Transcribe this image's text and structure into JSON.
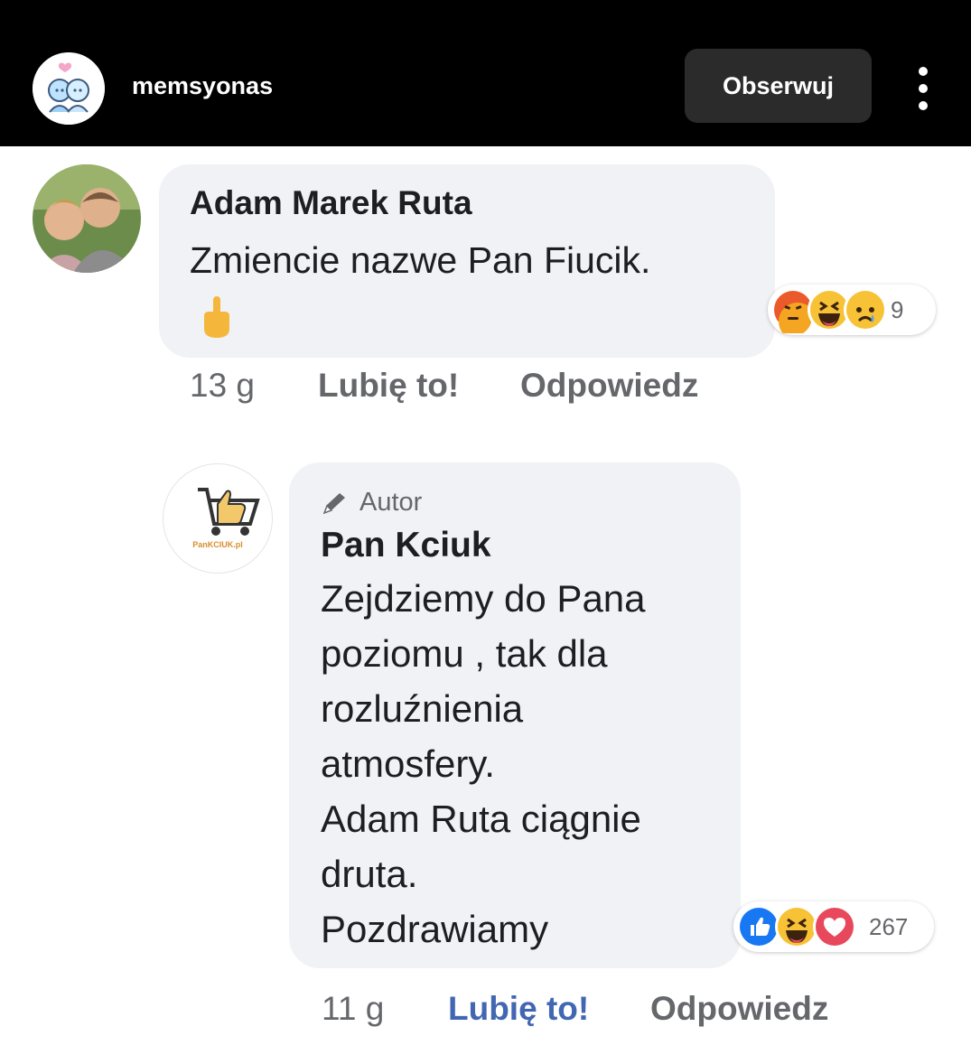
{
  "header": {
    "account_name": "memsyonas",
    "follow_label": "Obserwuj"
  },
  "comments": [
    {
      "author": "Adam Marek Ruta",
      "text": "Zmiencie nazwe Pan Fiucik.",
      "emoji": "middle-finger-emoji",
      "reactions": [
        "angry",
        "haha",
        "sad"
      ],
      "reaction_count": "9",
      "time": "13 g",
      "like_label": "Lubię to!",
      "reply_label": "Odpowiedz"
    },
    {
      "badge": "Autor",
      "author": "Pan Kciuk",
      "avatar_text": "PanKCIUK.pl",
      "lines": [
        "Zejdziemy do Pana",
        "poziomu , tak dla",
        "rozluźnienia",
        "atmosfery.",
        "Adam Ruta ciągnie",
        "druta.",
        "Pozdrawiamy"
      ],
      "reactions": [
        "like",
        "haha",
        "love"
      ],
      "reaction_count": "267",
      "time": "11 g",
      "like_label": "Lubię to!",
      "reply_label": "Odpowiedz"
    }
  ],
  "colors": {
    "bubble": "#f0f2f5",
    "meta_text": "#65676b",
    "liked": "#4267b2",
    "topbar": "#000000"
  }
}
